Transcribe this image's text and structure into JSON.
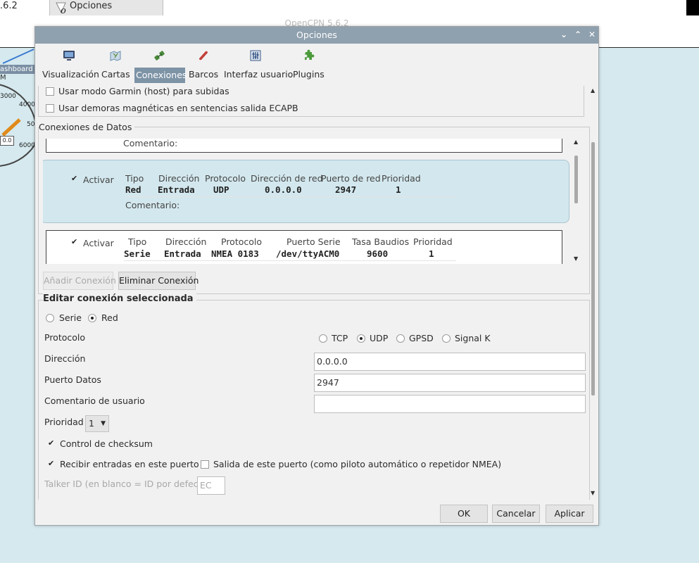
{
  "background": {
    "version_text": ".6.2",
    "options_tab": "Opciones",
    "window_title": "OpenCPN 5.6.2",
    "dashboard_label": "ashboard",
    "dashboard_sublabel": "M",
    "gauge": {
      "t1": "3000",
      "t2": "4000",
      "t3": "50",
      "t4": "6000",
      "box": "0.0"
    }
  },
  "dialog": {
    "title": "Opciones",
    "controls": {
      "minimize": "⌄",
      "maximize": "⌃",
      "close": "✕"
    }
  },
  "toolbar": {
    "items": [
      {
        "label": "Visualización",
        "icon": "monitor-icon",
        "color": "#3a4a6b"
      },
      {
        "label": "Cartas",
        "icon": "charts-icon",
        "color": "#6a8fb0"
      },
      {
        "label": "Conexiones",
        "icon": "connections-icon",
        "color": "#4a8a3a"
      },
      {
        "label": "Barcos",
        "icon": "ships-icon",
        "color": "#c2413a"
      },
      {
        "label": "Interfaz usuario",
        "icon": "user-interface-icon",
        "color": "#3a5a8a"
      },
      {
        "label": "Plugins",
        "icon": "plugins-icon",
        "color": "#4a9a3a"
      }
    ],
    "active_index": 2
  },
  "general_options": {
    "garmin_label": "Usar modo Garmin (host) para subidas",
    "garmin_checked": false,
    "magnetic_label": "Usar demoras magnéticas en sentencias salida ECAPB",
    "magnetic_checked": false
  },
  "data_connections": {
    "legend": "Conexiones de Datos",
    "partial_comment_label": "Comentario:",
    "connections": [
      {
        "enabled": true,
        "activate_label": "Activar",
        "headers": [
          "Tipo",
          "Dirección",
          "Protocolo",
          "Dirección de red",
          "Puerto de red",
          "Prioridad"
        ],
        "values": [
          "Red",
          "Entrada",
          "UDP",
          "0.0.0.0",
          "2947",
          "1"
        ],
        "comment_label": "Comentario:",
        "selected": true
      },
      {
        "enabled": true,
        "activate_label": "Activar",
        "headers": [
          "Tipo",
          "Dirección",
          "Protocolo",
          "Puerto Serie",
          "Tasa Baudios",
          "Prioridad"
        ],
        "values": [
          "Serie",
          "Entrada",
          "NMEA 0183",
          "/dev/ttyACM0",
          "9600",
          "1"
        ],
        "selected": false
      }
    ],
    "add_button": "Añadir Conexión",
    "remove_button": "Eliminar Conexión"
  },
  "edit_connection": {
    "legend": "Editar conexión seleccionada",
    "type_options": [
      "Serie",
      "Red"
    ],
    "type_selected": "Red",
    "protocol_label": "Protocolo",
    "protocol_options": [
      "TCP",
      "UDP",
      "GPSD",
      "Signal K"
    ],
    "protocol_selected": "UDP",
    "address_label": "Dirección",
    "address_value": "0.0.0.0",
    "port_label": "Puerto Datos",
    "port_value": "2947",
    "comment_label": "Comentario de usuario",
    "comment_value": "",
    "priority_label": "Prioridad",
    "priority_value": "1",
    "checksum_label": "Control de checksum",
    "checksum_checked": true,
    "receive_label": "Recibir entradas en este puerto",
    "receive_checked": true,
    "output_label": "Salida de este puerto (como piloto automático o repetidor NMEA)",
    "output_checked": false,
    "talker_label": "Talker ID (en blanco = ID por defecto)",
    "talker_placeholder": "EC"
  },
  "footer": {
    "ok": "OK",
    "cancel": "Cancelar",
    "apply": "Aplicar"
  }
}
